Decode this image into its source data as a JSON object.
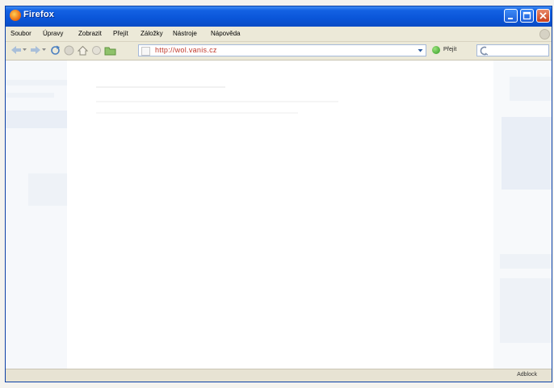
{
  "window": {
    "title": "Firefox"
  },
  "menubar": {
    "items": [
      {
        "label": "Soubor"
      },
      {
        "label": "Úpravy"
      },
      {
        "label": "Zobrazit"
      },
      {
        "label": "Přejít"
      },
      {
        "label": "Záložky"
      },
      {
        "label": "Nástroje"
      },
      {
        "label": "Nápověda"
      }
    ]
  },
  "navbar": {
    "url": "http://wol.vanis.cz",
    "go_label": "Přejít",
    "search_placeholder": ""
  },
  "statusbar": {
    "adblock": "Adblock"
  },
  "colors": {
    "titlebar": "#0a55d8",
    "url_text": "#c0392b",
    "chrome": "#ece9d8"
  }
}
